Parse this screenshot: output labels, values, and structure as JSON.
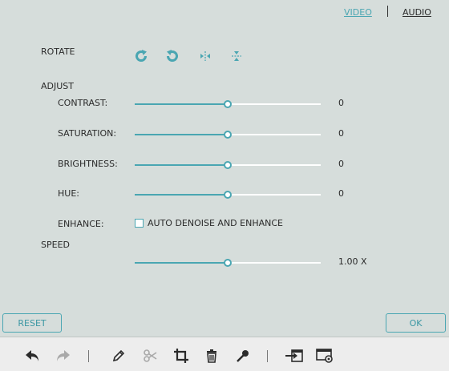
{
  "tabs": {
    "video": "VIDEO",
    "audio": "AUDIO",
    "active": "video"
  },
  "rotate": {
    "label": "ROTATE",
    "icons": [
      "rotate-clockwise-icon",
      "rotate-counterclockwise-icon",
      "flip-horizontal-icon",
      "flip-vertical-icon"
    ]
  },
  "adjust": {
    "label": "ADJUST",
    "contrast": {
      "label": "CONTRAST:",
      "value": "0",
      "level": 0.5
    },
    "saturation": {
      "label": "SATURATION:",
      "value": "0",
      "level": 0.5
    },
    "brightness": {
      "label": "BRIGHTNESS:",
      "value": "0",
      "level": 0.5
    },
    "hue": {
      "label": "HUE:",
      "value": "0",
      "level": 0.5
    },
    "enhance": {
      "label": "ENHANCE:",
      "checkbox_label": "AUTO DENOISE AND ENHANCE",
      "checked": false
    }
  },
  "speed": {
    "label": "SPEED",
    "value": "1.00 X",
    "level": 0.5
  },
  "buttons": {
    "reset": "RESET",
    "ok": "OK"
  },
  "toolbar": [
    "undo-icon",
    "redo-icon",
    "edit-pencil-icon",
    "cut-scissors-icon",
    "crop-icon",
    "delete-trash-icon",
    "microphone-icon",
    "export-icon",
    "settings-icon"
  ],
  "colors": {
    "accent": "#4aa6b2",
    "panel": "#d6dddb",
    "toolbar": "#ededed",
    "text": "#2b2b2b"
  }
}
